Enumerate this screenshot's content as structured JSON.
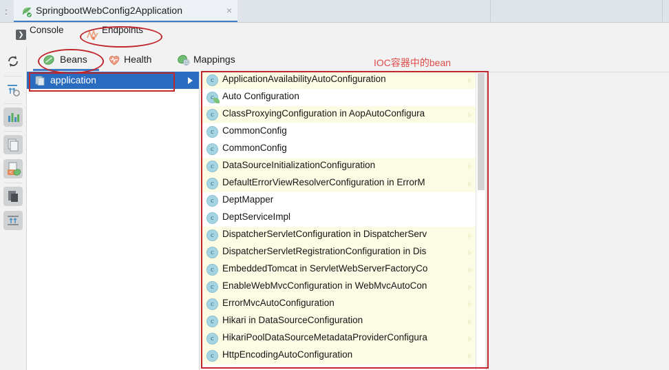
{
  "window": {
    "run_tab": {
      "title": "SpringbootWebConfig2Application",
      "icon": "spring-boot-run-icon",
      "close_icon": "close-icon",
      "close_label": "×"
    },
    "left_dots": ":"
  },
  "toolbar_primary": {
    "items": [
      {
        "label": "Console",
        "icon": "console-icon",
        "glyph": "❯"
      },
      {
        "label": "Endpoints",
        "icon": "endpoints-chart-icon"
      }
    ]
  },
  "toolbar_secondary": {
    "items": [
      {
        "label": "Beans",
        "icon": "beans-leaf-icon",
        "selected": true
      },
      {
        "label": "Health",
        "icon": "health-heart-icon",
        "selected": false
      },
      {
        "label": "Mappings",
        "icon": "mappings-globe-icon",
        "selected": false
      }
    ]
  },
  "gutter": {
    "buttons": [
      {
        "name": "rerun-icon"
      },
      {
        "name": "thread-dump-icon"
      },
      {
        "name": "chart-bars-icon"
      },
      {
        "name": "copy-pages-icon"
      },
      {
        "name": "export-bean-icon"
      },
      {
        "name": "layers-icon"
      },
      {
        "name": "expand-rows-icon"
      }
    ]
  },
  "tree": {
    "rows": [
      {
        "label": "application",
        "icon": "module-icon",
        "selected": true,
        "expandable": true
      }
    ]
  },
  "bean_list": {
    "items": [
      {
        "label": "ApplicationAvailabilityAutoConfiguration",
        "icon": "class-icon",
        "spring": false,
        "stripe": "y",
        "expandable": true
      },
      {
        "label": "Auto Configuration",
        "icon": "class-icon",
        "spring": true,
        "stripe": "w",
        "expandable": false
      },
      {
        "label": "ClassProxyingConfiguration in AopAutoConfigura",
        "icon": "class-icon",
        "spring": false,
        "stripe": "y",
        "expandable": true
      },
      {
        "label": "CommonConfig",
        "icon": "class-icon",
        "spring": false,
        "stripe": "w",
        "expandable": false
      },
      {
        "label": "CommonConfig",
        "icon": "class-icon",
        "spring": false,
        "stripe": "w",
        "expandable": false
      },
      {
        "label": "DataSourceInitializationConfiguration",
        "icon": "class-icon",
        "spring": false,
        "stripe": "y",
        "expandable": true
      },
      {
        "label": "DefaultErrorViewResolverConfiguration in ErrorM",
        "icon": "class-icon",
        "spring": false,
        "stripe": "y",
        "expandable": true
      },
      {
        "label": "DeptMapper",
        "icon": "class-icon",
        "spring": false,
        "stripe": "w",
        "expandable": false
      },
      {
        "label": "DeptServiceImpl",
        "icon": "class-icon",
        "spring": false,
        "stripe": "w",
        "expandable": false
      },
      {
        "label": "DispatcherServletConfiguration in DispatcherServ",
        "icon": "class-icon",
        "spring": false,
        "stripe": "y",
        "expandable": true
      },
      {
        "label": "DispatcherServletRegistrationConfiguration in Dis",
        "icon": "class-icon",
        "spring": false,
        "stripe": "y",
        "expandable": true
      },
      {
        "label": "EmbeddedTomcat in ServletWebServerFactoryCo",
        "icon": "class-icon",
        "spring": false,
        "stripe": "y",
        "expandable": true
      },
      {
        "label": "EnableWebMvcConfiguration in WebMvcAutoCon",
        "icon": "class-icon",
        "spring": false,
        "stripe": "y",
        "expandable": true
      },
      {
        "label": "ErrorMvcAutoConfiguration",
        "icon": "class-icon",
        "spring": false,
        "stripe": "y",
        "expandable": true
      },
      {
        "label": "Hikari in DataSourceConfiguration",
        "icon": "class-icon",
        "spring": false,
        "stripe": "y",
        "expandable": true
      },
      {
        "label": "HikariPoolDataSourceMetadataProviderConfigura",
        "icon": "class-icon",
        "spring": false,
        "stripe": "y",
        "expandable": true
      },
      {
        "label": "HttpEncodingAutoConfiguration",
        "icon": "class-icon",
        "spring": false,
        "stripe": "y",
        "expandable": true
      }
    ]
  },
  "annotations": {
    "note_cn": "IOC容器中的bean",
    "highlight_color": "#c0272d"
  }
}
